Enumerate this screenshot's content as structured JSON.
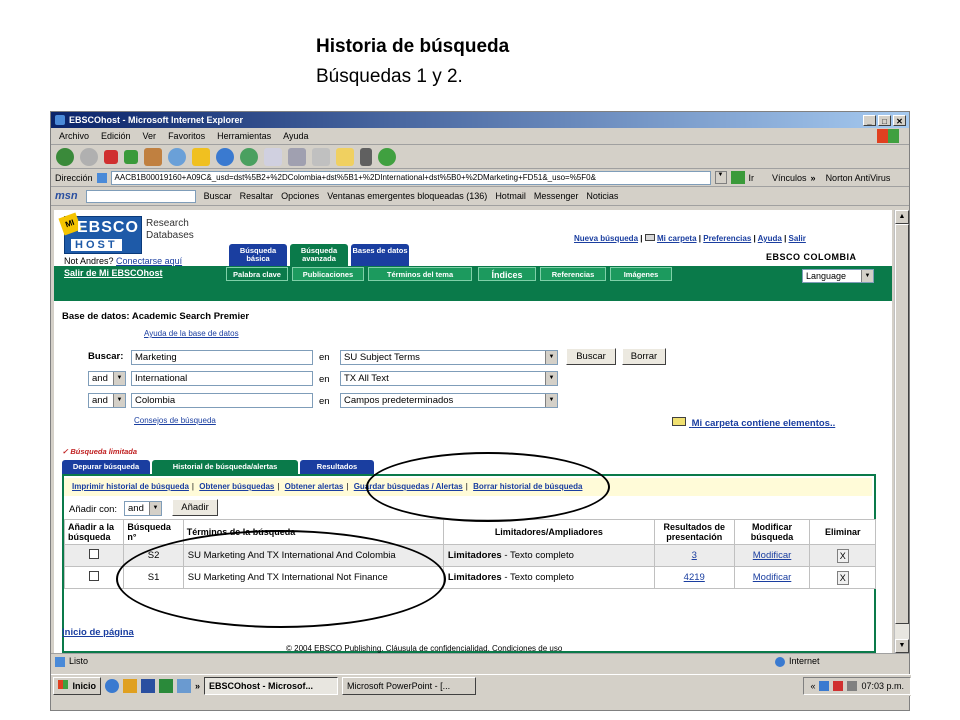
{
  "slide": {
    "title": "Historia de búsqueda",
    "subtitle": "Búsquedas 1 y 2."
  },
  "window": {
    "title": "EBSCOhost - Microsoft Internet Explorer",
    "menu": [
      "Archivo",
      "Edición",
      "Ver",
      "Favoritos",
      "Herramientas",
      "Ayuda"
    ],
    "address_label": "Dirección",
    "address": "AACB1B00019160+A09C&_usd=dst%5B2+%2DColombia+dst%5B1+%2DInternational+dst%5B0+%2DMarketing+FD51&_uso=%5F0&",
    "go_label": "Ir",
    "links_label": "Vínculos",
    "norton": "Norton AntiVirus",
    "msn": {
      "logo": "msn",
      "search": "Buscar",
      "highlight": "Resaltar",
      "options": "Opciones",
      "popups": "Ventanas emergentes bloqueadas (136)",
      "hotmail": "Hotmail",
      "messenger": "Messenger",
      "news": "Noticias"
    }
  },
  "page": {
    "logo_mi": "MI",
    "logo_ebsco": "EBSCO",
    "logo_host": "HOST",
    "research_lines": [
      "Research",
      "Databases"
    ],
    "not_user": "Not Andres?",
    "connect_link": "Conectarse aquí",
    "exit_link": "Salir de Mi EBSCOhost",
    "top_tabs": [
      {
        "label": "Búsqueda básica",
        "color": "#1a3ea0"
      },
      {
        "label": "Búsqueda avanzada",
        "color": "#0a7a4a"
      },
      {
        "label": "Bases de datos",
        "color": "#1a3ea0"
      }
    ],
    "top_links": [
      "Nueva búsqueda",
      "Mi carpeta",
      "Preferencias",
      "Ayuda",
      "Salir"
    ],
    "org": "EBSCO COLOMBIA",
    "sub_tabs": [
      "Palabra clave",
      "Publicaciones",
      "Términos del tema",
      "Índices",
      "Referencias",
      "Imágenes"
    ],
    "language": "Language",
    "db_label": "Base de datos:",
    "db_name": "Academic Search Premier",
    "db_help": "Ayuda de la base de datos",
    "search_label": "Buscar:",
    "rows": [
      {
        "op": "",
        "term": "Marketing",
        "en": "en",
        "field": "SU Subject Terms"
      },
      {
        "op": "and",
        "term": "International",
        "en": "en",
        "field": "TX All Text"
      },
      {
        "op": "and",
        "term": "Colombia",
        "en": "en",
        "field": "Campos predeterminados"
      }
    ],
    "search_button": "Buscar",
    "clear_button": "Borrar",
    "tips_link": "Consejos de búsqueda",
    "folder_msg": "Mi carpeta contiene elementos..",
    "limited": "✓ Búsqueda limitada",
    "hist_tabs": [
      "Depurar búsqueda",
      "Historial de búsqueda/alertas",
      "Resultados"
    ],
    "hist_links": [
      "Imprimir historial de búsqueda",
      "Obtener búsquedas",
      "Obtener alertas",
      "Guardar búsquedas / Alertas",
      "Borrar historial de búsqueda"
    ],
    "add_with_label": "Añadir con:",
    "add_with_value": "and",
    "add_button": "Añadir",
    "table_headers": [
      "Añadir a la búsqueda",
      "Búsqueda n°",
      "Términos de la búsqueda",
      "Limitadores/Ampliadores",
      "Resultados de presentación",
      "Modificar búsqueda",
      "Eliminar"
    ],
    "table_rows": [
      {
        "id": "S2",
        "terms": "SU Marketing And TX International And Colombia",
        "limit_bold": "Limitadores",
        "limit_rest": " - Texto completo",
        "results": "3",
        "modify": "Modificar",
        "delete": "X"
      },
      {
        "id": "S1",
        "terms": "SU Marketing And TX International Not Finance",
        "limit_bold": "Limitadores",
        "limit_rest": " - Texto completo",
        "results": "4219",
        "modify": "Modificar",
        "delete": "X"
      }
    ],
    "top_link": "Inicio de página",
    "footer": "© 2004 EBSCO Publishing. Cláusula de confidencialidad. Condiciones de uso"
  },
  "status": {
    "text": "Listo",
    "zone": "Internet"
  },
  "taskbar": {
    "start": "Inicio",
    "tasks": [
      "EBSCOhost - Microsof...",
      "Microsoft PowerPoint - [..."
    ],
    "clock": "07:03 p.m."
  }
}
